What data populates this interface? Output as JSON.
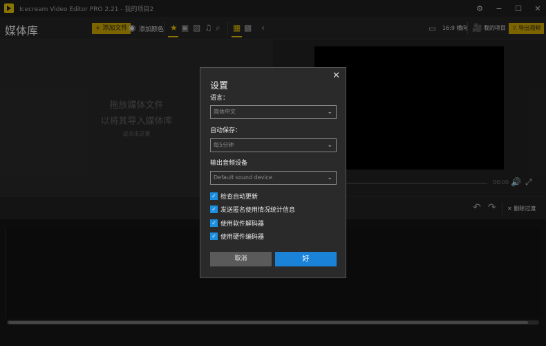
{
  "titlebar": {
    "app_title": "Icecream Video Editor PRO 2.21",
    "separator": "-",
    "project_name": "我的项目2"
  },
  "toolbar": {
    "panel_title": "媒体库",
    "add_file": "添加文件",
    "add_color": "添加颜色",
    "aspect_ratio": "16:9 横向",
    "my_project": "我的项目",
    "export_video": "导出视频"
  },
  "media_library": {
    "drop_hint_line1": "拖放媒体文件",
    "drop_hint_line2": "以将其导入媒体库",
    "drop_hint_line3": "或点击这里"
  },
  "preview": {
    "time": "00:00"
  },
  "edit_bar": {
    "remove_transitions": "删除过渡"
  },
  "settings_dialog": {
    "title": "设置",
    "language_label": "语言：",
    "language_value": "简体中文",
    "autosave_label": "自动保存：",
    "autosave_value": "每5分钟",
    "audio_label": "输出音频设备",
    "audio_value": "Default sound device",
    "checkboxes": [
      {
        "label": "检查自动更新",
        "checked": true
      },
      {
        "label": "发送匿名使用情况统计信息",
        "checked": true
      },
      {
        "label": "使用软件解码器",
        "checked": true
      },
      {
        "label": "使用硬件编码器",
        "checked": true
      }
    ],
    "cancel_label": "取消",
    "ok_label": "好"
  },
  "colors": {
    "accent_gold": "#bf9b00",
    "ok_blue": "#1a83d8",
    "checkbox_blue": "#1d8fe0"
  }
}
